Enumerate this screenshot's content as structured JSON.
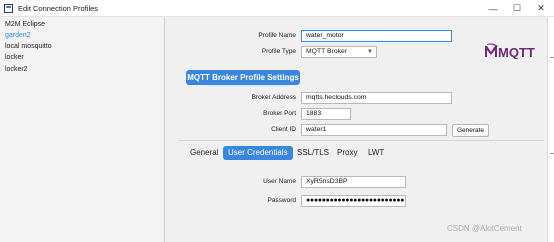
{
  "window": {
    "title": "Edit Connection Profiles",
    "minimize_glyph": "—",
    "maximize_glyph": "☐",
    "close_glyph": "✕"
  },
  "sidebar": {
    "items": [
      {
        "label": "M2M Eclipse",
        "selected": false
      },
      {
        "label": "garden2",
        "selected": true
      },
      {
        "label": "local mosquitto",
        "selected": false
      },
      {
        "label": "locker",
        "selected": false
      },
      {
        "label": "locker2",
        "selected": false
      }
    ]
  },
  "profile": {
    "name_label": "Profile Name",
    "name_value": "water_motor",
    "type_label": "Profile Type",
    "type_value": "MQTT Broker",
    "logo_text": "MQTT"
  },
  "broker": {
    "section_label": "MQTT Broker Profile Settings",
    "address_label": "Broker Address",
    "address_value": "mqtts.heclouds.com",
    "port_label": "Broker Port",
    "port_value": "1883",
    "client_id_label": "Client ID",
    "client_id_value": "water1",
    "generate_label": "Generate"
  },
  "tabs": [
    {
      "label": "General",
      "active": false
    },
    {
      "label": "User Credentials",
      "active": true
    },
    {
      "label": "SSL/TLS",
      "active": false
    },
    {
      "label": "Proxy",
      "active": false
    },
    {
      "label": "LWT",
      "active": false
    }
  ],
  "credentials": {
    "username_label": "User Name",
    "username_value": "XyR5nsD3BP",
    "password_label": "Password",
    "password_value": "●●●●●●●●●●●●●●●●●●●●●●●●●●●●●●●●●●●●"
  },
  "watermark": "CSDN @AlotCement",
  "colors": {
    "accent": "#3a86de",
    "selected_text": "#2e86de"
  }
}
